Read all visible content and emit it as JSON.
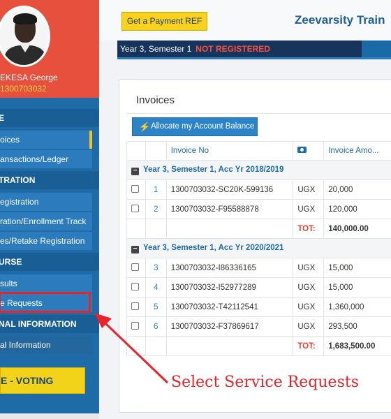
{
  "sidebar": {
    "profile": {
      "name": "EKESA George",
      "number": "1300703032"
    },
    "sections": [
      {
        "label": "E"
      },
      {
        "label": "TRATION"
      },
      {
        "label": "URSE"
      },
      {
        "label": "NAL INFORMATION"
      }
    ],
    "items": [
      {
        "label": "oices"
      },
      {
        "label": "ansactions/Ledger"
      },
      {
        "label": "egistration"
      },
      {
        "label": "ration/Enrollment Track"
      },
      {
        "label": "es/Retake Registration"
      },
      {
        "label": "sults"
      },
      {
        "label": "e Requests"
      },
      {
        "label": "al Information"
      }
    ],
    "voting_label": "E - VOTING"
  },
  "header": {
    "payment_button": "Get a Payment REF",
    "brand": "Zeevarsity Train",
    "semester_text": "Year 3, Semester 1",
    "status": "NOT REGISTERED"
  },
  "invoices": {
    "title": "Invoices",
    "allocate_button": "Allocate my Account Balance",
    "columns": {
      "invoice_no": "Invoice No",
      "invoice_amount": "Invoice Amo..."
    },
    "groups": [
      {
        "title": "Year 3, Semester 1, Acc Yr 2018/2019",
        "rows": [
          {
            "index": "1",
            "invoice_no": "1300703032-SC20K-599136",
            "currency": "UGX",
            "amount": "20,000"
          },
          {
            "index": "2",
            "invoice_no": "1300703032-F95588878",
            "currency": "UGX",
            "amount": "120,000"
          }
        ],
        "total_label": "TOT:",
        "total": "140,000.00"
      },
      {
        "title": "Year 3, Semester 1, Acc Yr 2020/2021",
        "rows": [
          {
            "index": "3",
            "invoice_no": "1300703032-I86336165",
            "currency": "UGX",
            "amount": "15,000"
          },
          {
            "index": "4",
            "invoice_no": "1300703032-I52977289",
            "currency": "UGX",
            "amount": "15,000"
          },
          {
            "index": "5",
            "invoice_no": "1300703032-T42112541",
            "currency": "UGX",
            "amount": "1,360,000"
          },
          {
            "index": "6",
            "invoice_no": "1300703032-F37869617",
            "currency": "UGX",
            "amount": "293,500"
          }
        ],
        "total_label": "TOT:",
        "total": "1,683,500.00"
      }
    ]
  },
  "annotation": {
    "text": "Select Service Requests",
    "color": "#e8232a"
  },
  "colors": {
    "sidebar": "#1f6ba8",
    "profile_bg": "#e8503e",
    "accent_yellow": "#f8d21c",
    "brand_blue": "#1c5e9e",
    "status_red": "#ff4d3d"
  }
}
